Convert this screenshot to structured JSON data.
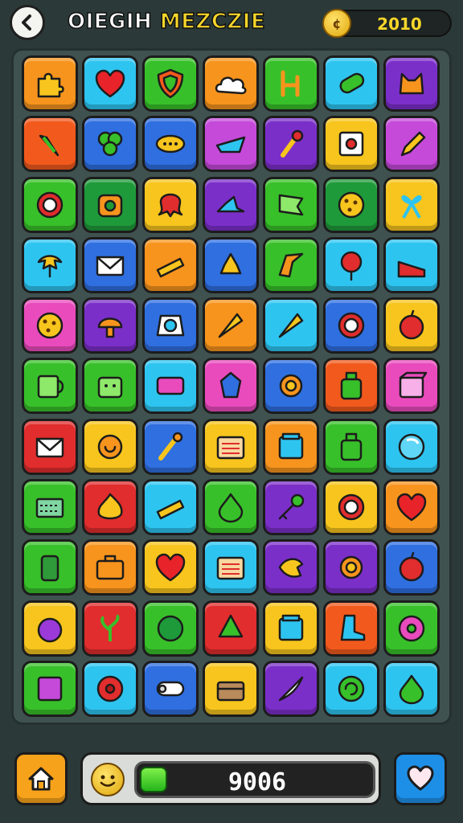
{
  "header": {
    "title_part1": "OIEGIH",
    "title_part2": "MEZCZIE",
    "coins": "2010",
    "back_icon": "chevron-left-icon",
    "coin_icon": "coin-icon"
  },
  "board": {
    "rows": [
      [
        {
          "color": "#f7941d",
          "icon": "puzzle"
        },
        {
          "color": "#2ec4f0",
          "icon": "heart"
        },
        {
          "color": "#38c02a",
          "icon": "shield"
        },
        {
          "color": "#f7941d",
          "icon": "cloud"
        },
        {
          "color": "#38c02a",
          "icon": "chair"
        },
        {
          "color": "#2ec4f0",
          "icon": "capsule"
        },
        {
          "color": "#7b2fc9",
          "icon": "cat"
        }
      ],
      [
        {
          "color": "#f25a1d",
          "icon": "carrot"
        },
        {
          "color": "#2f6fe0",
          "icon": "clover"
        },
        {
          "color": "#2f6fe0",
          "icon": "pill"
        },
        {
          "color": "#c54ad9",
          "icon": "boat"
        },
        {
          "color": "#7b2fc9",
          "icon": "torch"
        },
        {
          "color": "#f7c51d",
          "icon": "box"
        },
        {
          "color": "#c54ad9",
          "icon": "pencil"
        }
      ],
      [
        {
          "color": "#38c02a",
          "icon": "gear"
        },
        {
          "color": "#1f9a3a",
          "icon": "spool"
        },
        {
          "color": "#f7c51d",
          "icon": "octopus"
        },
        {
          "color": "#7b2fc9",
          "icon": "hat"
        },
        {
          "color": "#38c02a",
          "icon": "flag"
        },
        {
          "color": "#1f9a3a",
          "icon": "cookie"
        },
        {
          "color": "#f7c51d",
          "icon": "ribbon"
        }
      ],
      [
        {
          "color": "#2ec4f0",
          "icon": "leaf"
        },
        {
          "color": "#2f6fe0",
          "icon": "envelope"
        },
        {
          "color": "#f7941d",
          "icon": "cheese"
        },
        {
          "color": "#2f6fe0",
          "icon": "bell"
        },
        {
          "color": "#38c02a",
          "icon": "arrow"
        },
        {
          "color": "#2ec4f0",
          "icon": "balloon"
        },
        {
          "color": "#2ec4f0",
          "icon": "ramp"
        }
      ],
      [
        {
          "color": "#e94bbd",
          "icon": "cookie"
        },
        {
          "color": "#7b2fc9",
          "icon": "mushroom"
        },
        {
          "color": "#2f6fe0",
          "icon": "ring"
        },
        {
          "color": "#f7941d",
          "icon": "cone"
        },
        {
          "color": "#2ec4f0",
          "icon": "cone"
        },
        {
          "color": "#2f6fe0",
          "icon": "gear"
        },
        {
          "color": "#f7c51d",
          "icon": "apple"
        }
      ],
      [
        {
          "color": "#38c02a",
          "icon": "mug"
        },
        {
          "color": "#38c02a",
          "icon": "pot"
        },
        {
          "color": "#2ec4f0",
          "icon": "cassette"
        },
        {
          "color": "#e94bbd",
          "icon": "gem"
        },
        {
          "color": "#2f6fe0",
          "icon": "sun"
        },
        {
          "color": "#f25a1d",
          "icon": "bottle"
        },
        {
          "color": "#e94bbd",
          "icon": "cube"
        }
      ],
      [
        {
          "color": "#e12d2d",
          "icon": "envelope"
        },
        {
          "color": "#f7c51d",
          "icon": "snail"
        },
        {
          "color": "#2f6fe0",
          "icon": "brush"
        },
        {
          "color": "#f7c51d",
          "icon": "radio"
        },
        {
          "color": "#f7941d",
          "icon": "jar"
        },
        {
          "color": "#38c02a",
          "icon": "bottle"
        },
        {
          "color": "#2ec4f0",
          "icon": "bubble"
        }
      ],
      [
        {
          "color": "#38c02a",
          "icon": "keyboard"
        },
        {
          "color": "#e12d2d",
          "icon": "flame"
        },
        {
          "color": "#2ec4f0",
          "icon": "cheese"
        },
        {
          "color": "#38c02a",
          "icon": "drop"
        },
        {
          "color": "#7b2fc9",
          "icon": "key"
        },
        {
          "color": "#f7c51d",
          "icon": "gear"
        },
        {
          "color": "#f7941d",
          "icon": "heart"
        }
      ],
      [
        {
          "color": "#38c02a",
          "icon": "can"
        },
        {
          "color": "#f7941d",
          "icon": "bag"
        },
        {
          "color": "#f7c51d",
          "icon": "heart"
        },
        {
          "color": "#2ec4f0",
          "icon": "radio"
        },
        {
          "color": "#7b2fc9",
          "icon": "bird"
        },
        {
          "color": "#7b2fc9",
          "icon": "sun"
        },
        {
          "color": "#2f6fe0",
          "icon": "apple"
        }
      ],
      [
        {
          "color": "#f7c51d",
          "icon": "plum"
        },
        {
          "color": "#e12d2d",
          "icon": "plant"
        },
        {
          "color": "#38c02a",
          "icon": "bush"
        },
        {
          "color": "#e12d2d",
          "icon": "tree"
        },
        {
          "color": "#f7c51d",
          "icon": "jar"
        },
        {
          "color": "#f25a1d",
          "icon": "boot"
        },
        {
          "color": "#38c02a",
          "icon": "donut"
        }
      ],
      [
        {
          "color": "#38c02a",
          "icon": "book"
        },
        {
          "color": "#2ec4f0",
          "icon": "flower"
        },
        {
          "color": "#2f6fe0",
          "icon": "scroll"
        },
        {
          "color": "#f7c51d",
          "icon": "chest"
        },
        {
          "color": "#7b2fc9",
          "icon": "quill"
        },
        {
          "color": "#2ec4f0",
          "icon": "swirl"
        },
        {
          "color": "#2ec4f0",
          "icon": "drop"
        }
      ]
    ]
  },
  "footer": {
    "home_icon": "home-icon",
    "face_icon": "smiley-icon",
    "score": "9006",
    "progress_fraction": 0.12,
    "heart_icon": "heart-icon"
  }
}
